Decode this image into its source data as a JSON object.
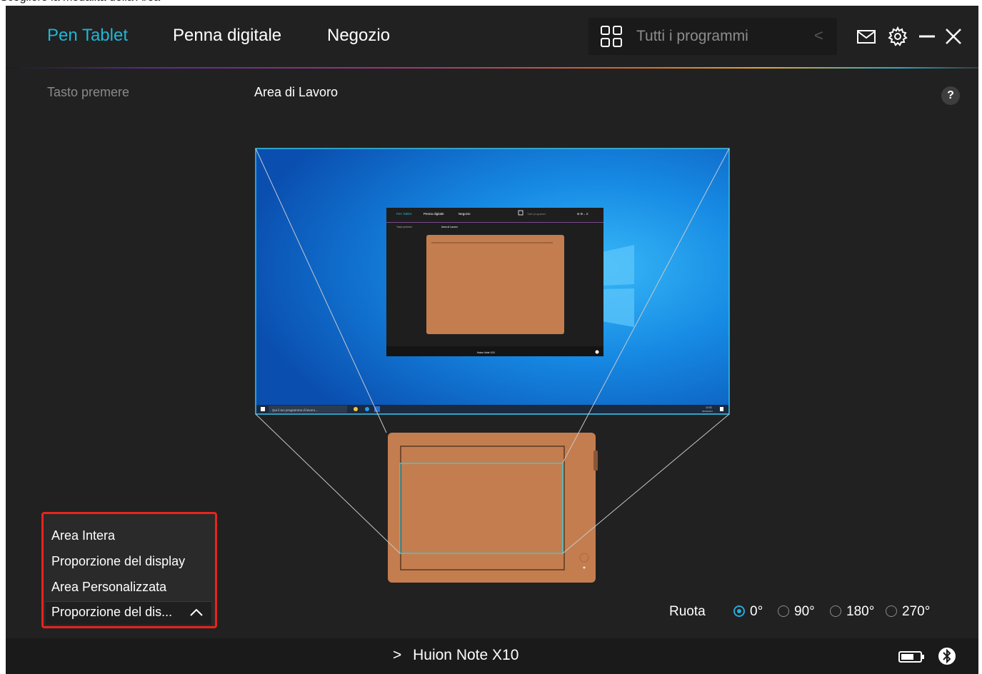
{
  "caption": "Scegliere la modalità della Area",
  "topbar": {
    "tabs": [
      {
        "label": "Pen Tablet",
        "active": true
      },
      {
        "label": "Penna digitale",
        "active": false
      },
      {
        "label": "Negozio",
        "active": false
      }
    ],
    "program_select": {
      "label": "Tutti i programmi",
      "icon": "grid-icon",
      "arrow": "<"
    },
    "icons": [
      "mail-icon",
      "gear-icon",
      "minimize-icon",
      "close-icon"
    ]
  },
  "sections": {
    "left": "Tasto premere",
    "center": "Area di Lavoro",
    "help": "?"
  },
  "preview": {
    "mini_app": {
      "tabs": [
        "Pen Tablet",
        "Penna digitale",
        "Negozio"
      ],
      "program_label": "Tutti i programmi",
      "section_left": "Tasto premere",
      "section_center": "Area di Lavoro",
      "device": "Huion Note X10"
    },
    "taskbar_search": "Qui il tuo programma di lavoro...",
    "taskbar_time": "10:53",
    "taskbar_date": "05/06/2021"
  },
  "mapping_mode": {
    "options": [
      "Area Intera",
      "Proporzione del display",
      "Area Personalizzata"
    ],
    "current": "Proporzione del dis...",
    "highlight_color": "#e8241c"
  },
  "rotation": {
    "label": "Ruota",
    "options": [
      {
        "label": "0°",
        "checked": true
      },
      {
        "label": "90°",
        "checked": false
      },
      {
        "label": "180°",
        "checked": false
      },
      {
        "label": "270°",
        "checked": false
      }
    ]
  },
  "device": {
    "name": "Huion Note X10",
    "chevron": ">"
  },
  "colors": {
    "accent": "#1fb6d6",
    "tablet": "#c47d4f",
    "desktop": "#0a78d8",
    "background": "#212121"
  }
}
